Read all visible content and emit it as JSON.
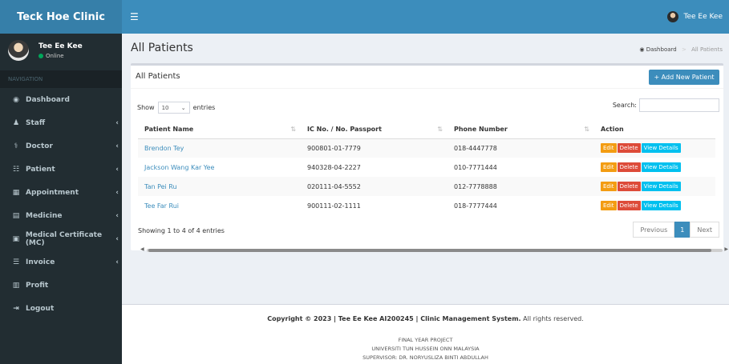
{
  "brand": "Teck Hoe Clinic",
  "top_user": "Tee Ee Kee",
  "sidebar": {
    "user_name": "Tee Ee Kee",
    "status": "Online",
    "nav_header": "NAVIGATION",
    "items": [
      {
        "label": "Dashboard",
        "icon": "dashboard-icon",
        "glyph": "◉",
        "chevron": ""
      },
      {
        "label": "Staff",
        "icon": "staff-icon",
        "glyph": "♟",
        "chevron": "‹"
      },
      {
        "label": "Doctor",
        "icon": "doctor-icon",
        "glyph": "⚕",
        "chevron": "‹"
      },
      {
        "label": "Patient",
        "icon": "patient-icon",
        "glyph": "☷",
        "chevron": "‹"
      },
      {
        "label": "Appointment",
        "icon": "calendar-icon",
        "glyph": "▦",
        "chevron": "‹"
      },
      {
        "label": "Medicine",
        "icon": "medicine-icon",
        "glyph": "▤",
        "chevron": "‹"
      },
      {
        "label": "Medical Certificate (MC)",
        "icon": "certificate-icon",
        "glyph": "▣",
        "chevron": "‹"
      },
      {
        "label": "Invoice",
        "icon": "invoice-icon",
        "glyph": "☰",
        "chevron": "‹"
      },
      {
        "label": "Profit",
        "icon": "profit-icon",
        "glyph": "▥",
        "chevron": ""
      },
      {
        "label": "Logout",
        "icon": "logout-icon",
        "glyph": "⇥",
        "chevron": ""
      }
    ]
  },
  "main": {
    "page_title": "All Patients",
    "breadcrumb": {
      "home": "Dashboard",
      "current": "All Patients"
    },
    "box_title": "All Patients",
    "add_button": "+ Add New Patient",
    "show_label": "Show",
    "entries_value": "10",
    "entries_label": "entries",
    "search_label": "Search:",
    "columns": [
      "Patient Name",
      "IC No. / No. Passport",
      "Phone Number",
      "Action"
    ],
    "rows": [
      {
        "name": "Brendon Tey",
        "ic": "900801-01-7779",
        "phone": "018-4447778"
      },
      {
        "name": "Jackson Wang Kar Yee",
        "ic": "940328-04-2227",
        "phone": "010-7771444"
      },
      {
        "name": "Tan Pei Ru",
        "ic": "020111-04-5552",
        "phone": "012-7778888"
      },
      {
        "name": "Tee Far Rui",
        "ic": "900111-02-1111",
        "phone": "018-7777444"
      }
    ],
    "actions": {
      "edit": "Edit",
      "delete": "Delete",
      "view": "View Details"
    },
    "showing": "Showing 1 to 4 of 4 entries",
    "pager": {
      "previous": "Previous",
      "page": "1",
      "next": "Next"
    }
  },
  "footer": {
    "copyright_prefix": "Copyright © 2023 | Tee Ee Kee AI200245 | Clinic Management System.",
    "copyright_suffix": " All rights reserved.",
    "line1": "FINAL YEAR PROJECT",
    "line2": "UNIVERSITI TUN HUSSEIN ONN MALAYSIA",
    "line3": "SUPERVISOR: DR. NORYUSLIZA BINTI ABDULLAH"
  }
}
